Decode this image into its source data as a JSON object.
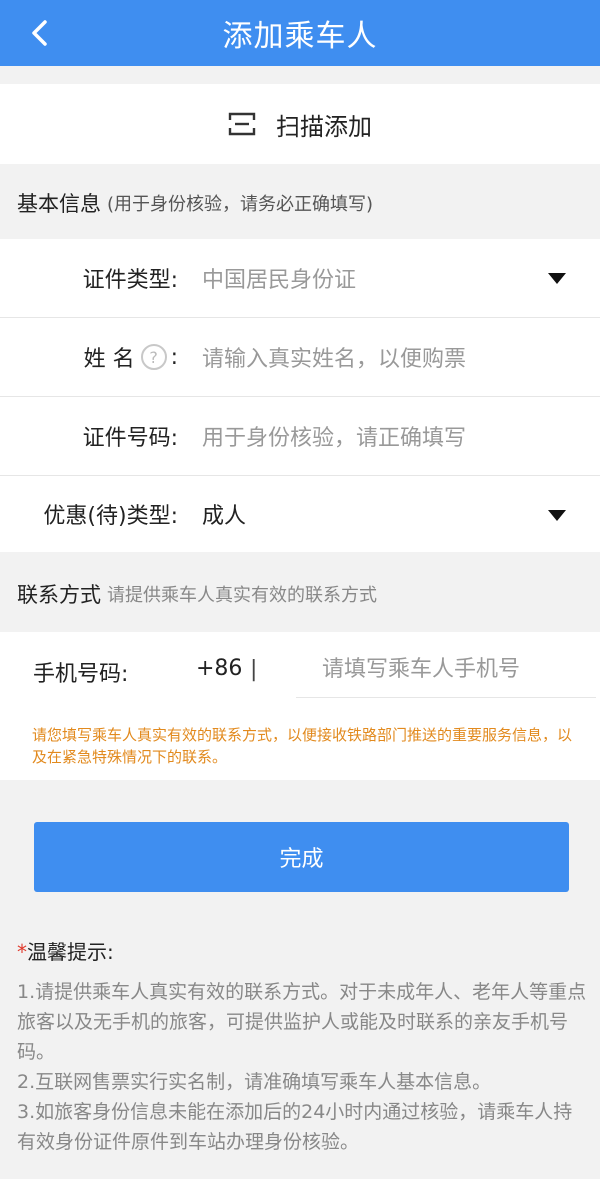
{
  "header": {
    "title": "添加乘车人"
  },
  "scan": {
    "label": "扫描添加"
  },
  "basic_section": {
    "title": "基本信息",
    "subtitle": "(用于身份核验，请务必正确填写)"
  },
  "form": {
    "id_type": {
      "label": "证件类型:",
      "value": "中国居民身份证"
    },
    "name": {
      "label_part1": "姓 名",
      "colon": ":",
      "help": "?",
      "placeholder": "请输入真实姓名，以便购票"
    },
    "id_number": {
      "label": "证件号码:",
      "placeholder": "用于身份核验，请正确填写"
    },
    "discount_type": {
      "label": "优惠(待)类型:",
      "value": "成人"
    }
  },
  "contact_section": {
    "title": "联系方式",
    "subtitle": "请提供乘车人真实有效的联系方式"
  },
  "contact": {
    "phone_label": "手机号码:",
    "prefix": "+86",
    "separator": "|",
    "phone_placeholder": "请填写乘车人手机号",
    "notice": "请您填写乘车人真实有效的联系方式，以便接收铁路部门推送的重要服务信息，以及在紧急特殊情况下的联系。"
  },
  "done_button": "完成",
  "tips": {
    "star": "*",
    "title": "温馨提示:",
    "items": [
      "1.请提供乘车人真实有效的联系方式。对于未成年人、老年人等重点旅客以及无手机的旅客，可提供监护人或能及时联系的亲友手机号码。",
      "2.互联网售票实行实名制，请准确填写乘车人基本信息。",
      "3.如旅客身份信息未能在添加后的24小时内通过核验，请乘车人持有效身份证件原件到车站办理身份核验。"
    ]
  },
  "colors": {
    "brand_blue": "#3f8ef0",
    "notice_orange": "#e28a1e",
    "required_red": "#e0392b"
  }
}
